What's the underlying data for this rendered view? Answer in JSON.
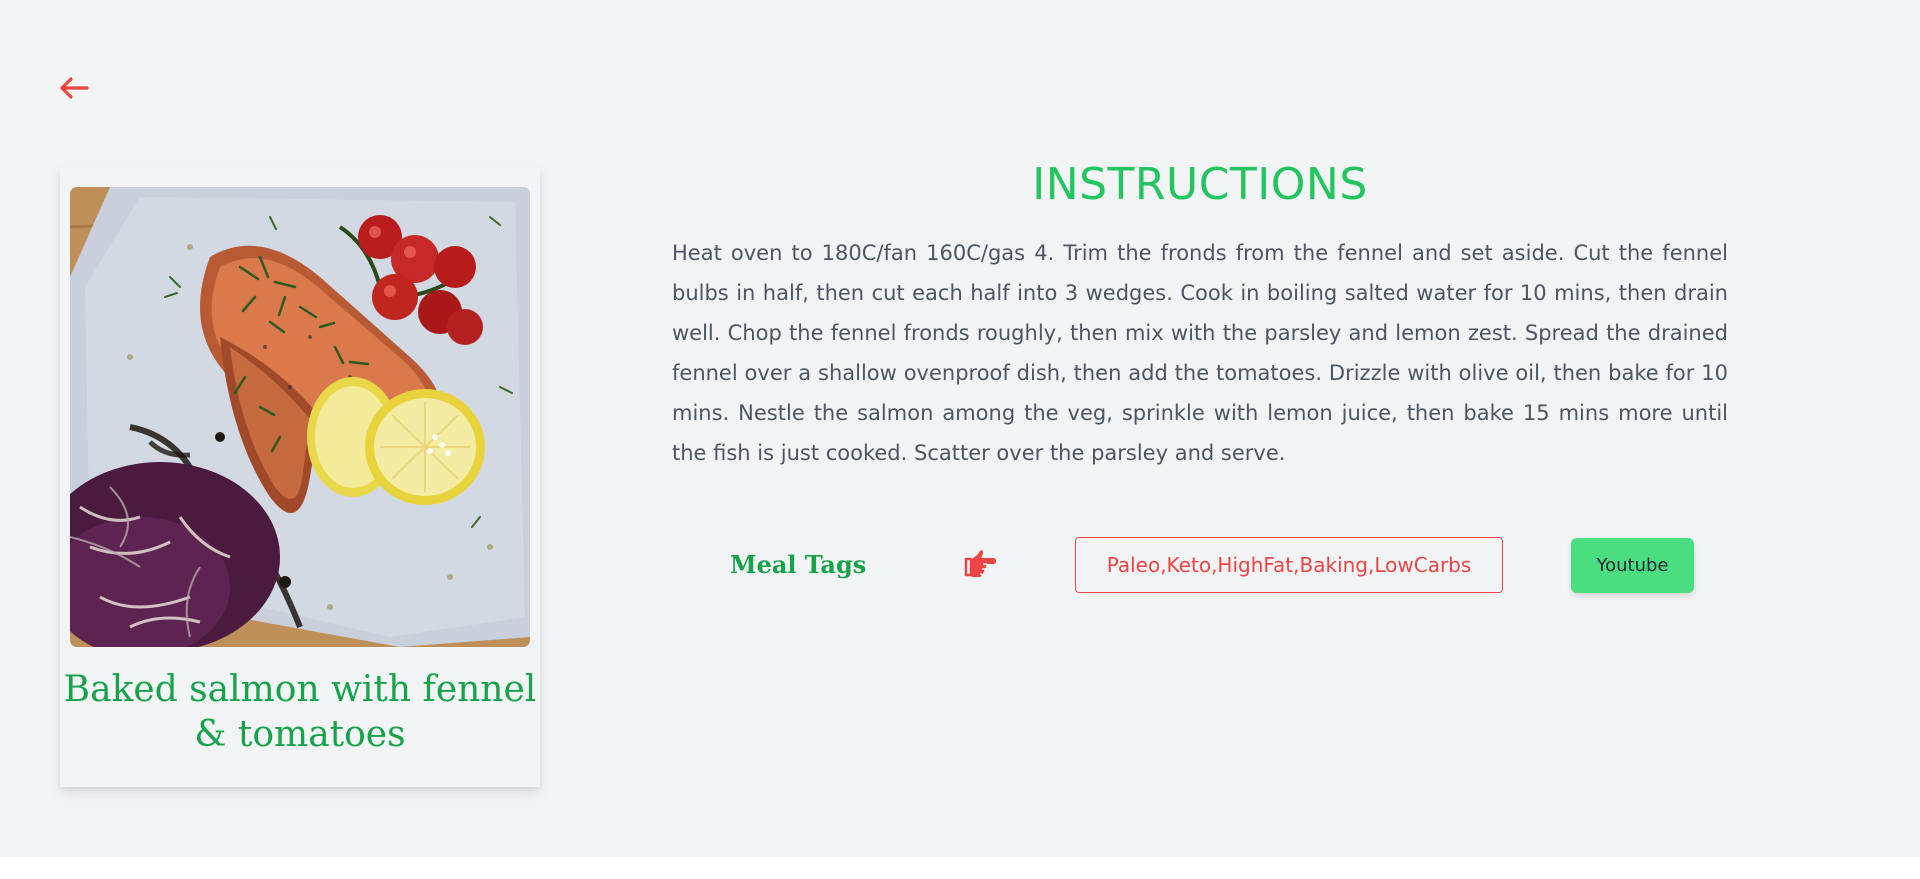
{
  "nav": {
    "back_icon": "arrow-left-icon"
  },
  "recipe": {
    "title": "Baked salmon with fennel & tomatoes",
    "image_icon": "salmon-dish-photo"
  },
  "instructions": {
    "heading": "INSTRUCTIONS",
    "text": "Heat oven to 180C/fan 160C/gas 4. Trim the fronds from the fennel and set aside. Cut the fennel bulbs in half, then cut each half into 3 wedges. Cook in boiling salted water for 10 mins, then drain well. Chop the fennel fronds roughly, then mix with the parsley and lemon zest. Spread the drained fennel over a shallow ovenproof dish, then add the tomatoes. Drizzle with olive oil, then bake for 10 mins. Nestle the salmon among the veg, sprinkle with lemon juice, then bake 15 mins more until the fish is just cooked. Scatter over the parsley and serve."
  },
  "tags": {
    "label": "Meal Tags",
    "pointer_icon": "hand-pointing-right-icon",
    "value": "Paleo,Keto,HighFat,Baking,LowCarbs"
  },
  "actions": {
    "youtube_label": "Youtube"
  },
  "colors": {
    "page_background": "#f3f4f6",
    "accent_green": "#16a34a",
    "heading_green": "#22c55e",
    "button_green": "#4ade80",
    "accent_red": "#ef4444",
    "body_text": "#4b5563"
  }
}
